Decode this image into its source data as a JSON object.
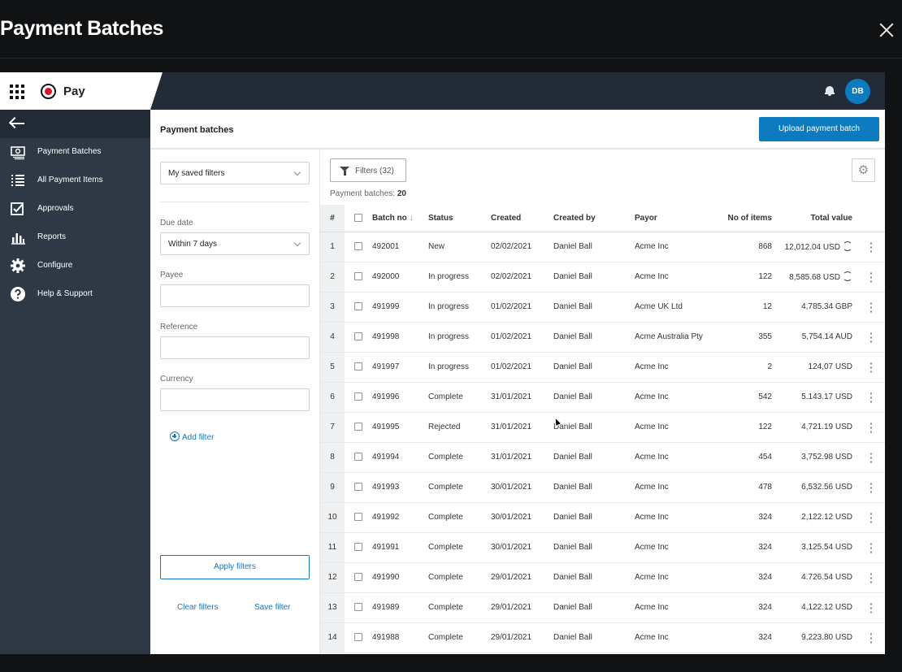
{
  "window": {
    "title": "Payment Batches"
  },
  "app": {
    "brand": "Pay",
    "avatar_initials": "DB"
  },
  "sidebar": {
    "items": [
      {
        "label": "Payment Batches",
        "icon": "money-icon"
      },
      {
        "label": "All Payment Items",
        "icon": "list-icon"
      },
      {
        "label": "Approvals",
        "icon": "checkbox-icon"
      },
      {
        "label": "Reports",
        "icon": "bar-chart-icon"
      },
      {
        "label": "Configure",
        "icon": "gear-icon"
      },
      {
        "label": "Help & Support",
        "icon": "help-icon"
      }
    ]
  },
  "header": {
    "title": "Payment batches",
    "upload_label": "Upload payment batch"
  },
  "filters": {
    "saved": "My saved filters",
    "due_date_label": "Due date",
    "due_date_value": "Within 7 days",
    "payee_label": "Payee",
    "reference_label": "Reference",
    "currency_label": "Currency",
    "add_filter": "Add filter",
    "apply": "Apply filters",
    "clear": "Clear filters",
    "save": "Save filter"
  },
  "table": {
    "filters_button": "Filters (32)",
    "count_label": "Payment batches:",
    "count_value": "20",
    "columns": [
      "#",
      "Batch no",
      "Status",
      "Created",
      "Created by",
      "Payor",
      "No of items",
      "Total value"
    ],
    "rows": [
      {
        "n": "1",
        "batch": "492001",
        "status": "New",
        "created": "02/02/2021",
        "by": "Daniel Ball",
        "payor": "Acme Inc",
        "items": "868",
        "total": "12,012.04 USD",
        "sync": true
      },
      {
        "n": "2",
        "batch": "492000",
        "status": "In progress",
        "created": "02/02/2021",
        "by": "Daniel Ball",
        "payor": "Acme Inc",
        "items": "122",
        "total": "8,585.68 USD",
        "sync": true
      },
      {
        "n": "3",
        "batch": "491999",
        "status": "In progress",
        "created": "01/02/2021",
        "by": "Daniel Ball",
        "payor": "Acme UK Ltd",
        "items": "12",
        "total": "4,785.34 GBP",
        "sync": false
      },
      {
        "n": "4",
        "batch": "491998",
        "status": "In progress",
        "created": "01/02/2021",
        "by": "Daniel Ball",
        "payor": "Acme Australia Pty",
        "items": "355",
        "total": "5,754.14 AUD",
        "sync": false
      },
      {
        "n": "5",
        "batch": "491997",
        "status": "In progress",
        "created": "01/02/2021",
        "by": "Daniel Ball",
        "payor": "Acme Inc",
        "items": "2",
        "total": "124,07 USD",
        "sync": false
      },
      {
        "n": "6",
        "batch": "491996",
        "status": "Complete",
        "created": "31/01/2021",
        "by": "Daniel Ball",
        "payor": "Acme Inc",
        "items": "542",
        "total": "5.143.17 USD",
        "sync": false
      },
      {
        "n": "7",
        "batch": "491995",
        "status": "Rejected",
        "created": "31/01/2021",
        "by": "Daniel Ball",
        "payor": "Acme Inc",
        "items": "122",
        "total": "4,721.19 USD",
        "sync": false
      },
      {
        "n": "8",
        "batch": "491994",
        "status": "Complete",
        "created": "31/01/2021",
        "by": "Daniel Ball",
        "payor": "Acme Inc",
        "items": "454",
        "total": "3,752.98 USD",
        "sync": false
      },
      {
        "n": "9",
        "batch": "491993",
        "status": "Complete",
        "created": "30/01/2021",
        "by": "Daniel Ball",
        "payor": "Acme Inc",
        "items": "478",
        "total": "6,532.56 USD",
        "sync": false
      },
      {
        "n": "10",
        "batch": "491992",
        "status": "Complete",
        "created": "30/01/2021",
        "by": "Daniel Ball",
        "payor": "Acme Inc",
        "items": "324",
        "total": "2,122.12 USD",
        "sync": false
      },
      {
        "n": "11",
        "batch": "491991",
        "status": "Complete",
        "created": "30/01/2021",
        "by": "Daniel Ball",
        "payor": "Acme Inc",
        "items": "324",
        "total": "3,125.54 USD",
        "sync": false
      },
      {
        "n": "12",
        "batch": "491990",
        "status": "Complete",
        "created": "29/01/2021",
        "by": "Daniel Ball",
        "payor": "Acme Inc",
        "items": "324",
        "total": "4.726.54 USD",
        "sync": false
      },
      {
        "n": "13",
        "batch": "491989",
        "status": "Complete",
        "created": "29/01/2021",
        "by": "Daniel Ball",
        "payor": "Acme Inc",
        "items": "324",
        "total": "4,122.12 USD",
        "sync": false
      },
      {
        "n": "14",
        "batch": "491988",
        "status": "Complete",
        "created": "29/01/2021",
        "by": "Daniel Ball",
        "payor": "Acme Inc",
        "items": "324",
        "total": "9,223.80 USD",
        "sync": false
      }
    ]
  },
  "colors": {
    "accent": "#0c7bc0",
    "topbar": "#222b36",
    "sidebar": "#2e3945",
    "brand_red": "#e0112b"
  }
}
